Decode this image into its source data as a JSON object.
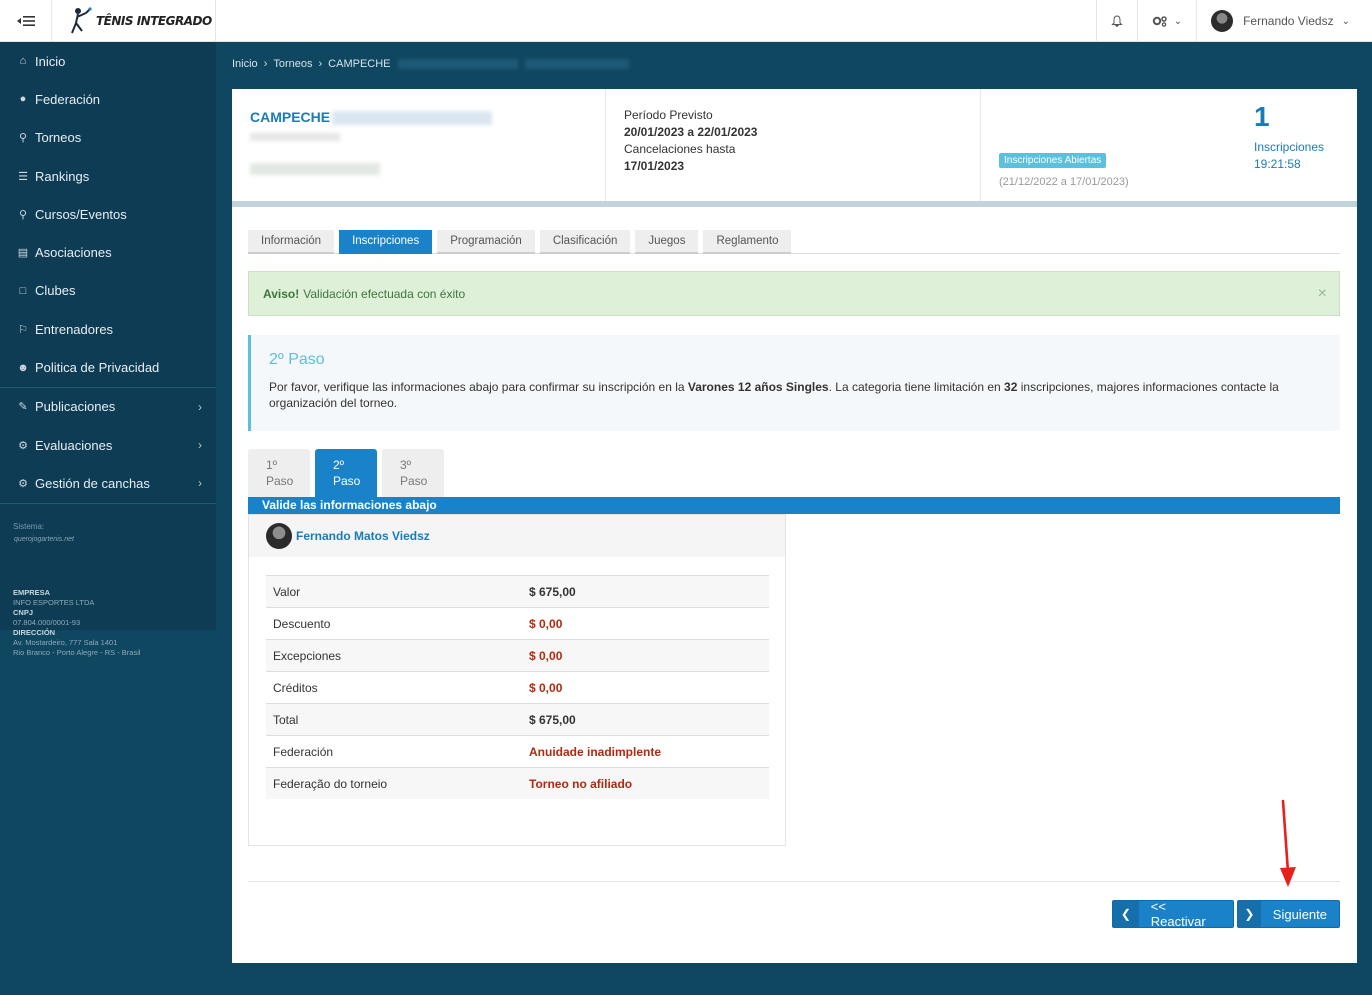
{
  "header": {
    "brand": "TÊNIS INTEGRADO",
    "user_name": "Fernando Viedsz"
  },
  "sidebar": {
    "items": [
      {
        "label": "Inicio",
        "icon": "home-icon"
      },
      {
        "label": "Federación",
        "icon": "globe-icon"
      },
      {
        "label": "Torneos",
        "icon": "trophy-icon"
      },
      {
        "label": "Rankings",
        "icon": "list-icon"
      },
      {
        "label": "Cursos/Eventos",
        "icon": "trophy-icon"
      },
      {
        "label": "Asociaciones",
        "icon": "bank-icon"
      },
      {
        "label": "Clubes",
        "icon": "folder-icon"
      },
      {
        "label": "Entrenadores",
        "icon": "flag-icon"
      },
      {
        "label": "Politica de Privacidad",
        "icon": "users-icon"
      },
      {
        "label": "Publicaciones",
        "icon": "edit-icon"
      },
      {
        "label": "Evaluaciones",
        "icon": "gear-icon"
      },
      {
        "label": "Gestión de canchas",
        "icon": "gear-icon"
      }
    ],
    "system_label": "Sistema:",
    "system_logo": "querojogartenis.net",
    "company_label": "EMPRESA",
    "company_value": "INFO ESPORTES LTDA",
    "cnpj_label": "CNPJ",
    "cnpj_value": "07.804.000/0001-93",
    "address_label": "DIRECCIÓN",
    "address_line1": "Av. Mostardeiro, 777 Sala 1401",
    "address_line2": "Rio Branco - Porto Alegre - RS - Brasil"
  },
  "breadcrumb": [
    "Inicio",
    "Torneos",
    "CAMPECHE"
  ],
  "tournament": {
    "name": "CAMPECHE",
    "period_label": "Período Previsto",
    "period_value": "20/01/2023 a 22/01/2023",
    "cancel_label": "Cancelaciones hasta",
    "cancel_value": "17/01/2023",
    "status_badge": "Inscripciones Abiertas",
    "status_dates": "(21/12/2022 a 17/01/2023)",
    "count": "1",
    "count_label": "Inscripciones",
    "count_time": "19:21:58"
  },
  "tabs": [
    "Información",
    "Inscripciones",
    "Programación",
    "Clasificación",
    "Juegos",
    "Reglamento"
  ],
  "alert": {
    "title": "Aviso!",
    "message": "Validación efectuada con éxito",
    "close": "×"
  },
  "info": {
    "title": "2º Paso",
    "text_1": "Por favor, verifique las informaciones abajo para confirmar su inscripción en la ",
    "category": "Varones 12 años Singles",
    "text_2": ". La categoria tiene limitación en ",
    "limit": "32",
    "text_3": " inscripciones, majores informaciones contacte la organización del torneo."
  },
  "steps": [
    {
      "num": "1º",
      "label": "Paso"
    },
    {
      "num": "2º",
      "label": "Paso"
    },
    {
      "num": "3º",
      "label": "Paso"
    }
  ],
  "steps_bar": "Valide las informaciones abajo",
  "player": {
    "name": "Fernando Matos Viedsz"
  },
  "values": [
    {
      "key": "Valor",
      "value": "$ 675,00",
      "red": false
    },
    {
      "key": "Descuento",
      "value": "$ 0,00",
      "red": true
    },
    {
      "key": "Excepciones",
      "value": "$ 0,00",
      "red": true
    },
    {
      "key": "Créditos",
      "value": "$ 0,00",
      "red": true
    },
    {
      "key": "Total",
      "value": "$ 675,00",
      "red": false
    },
    {
      "key": "Federación",
      "value": "Anuidade inadimplente",
      "red": true
    },
    {
      "key": "Federação do torneio",
      "value": "Torneo no afiliado",
      "red": true
    }
  ],
  "buttons": {
    "back": "<< Reactivar",
    "next": "Siguiente"
  },
  "colors": {
    "primary": "#1a82c8",
    "sidebar": "#0d3c54",
    "background": "#0f4660",
    "danger": "#b02a10",
    "success_bg": "#dff0d8"
  }
}
